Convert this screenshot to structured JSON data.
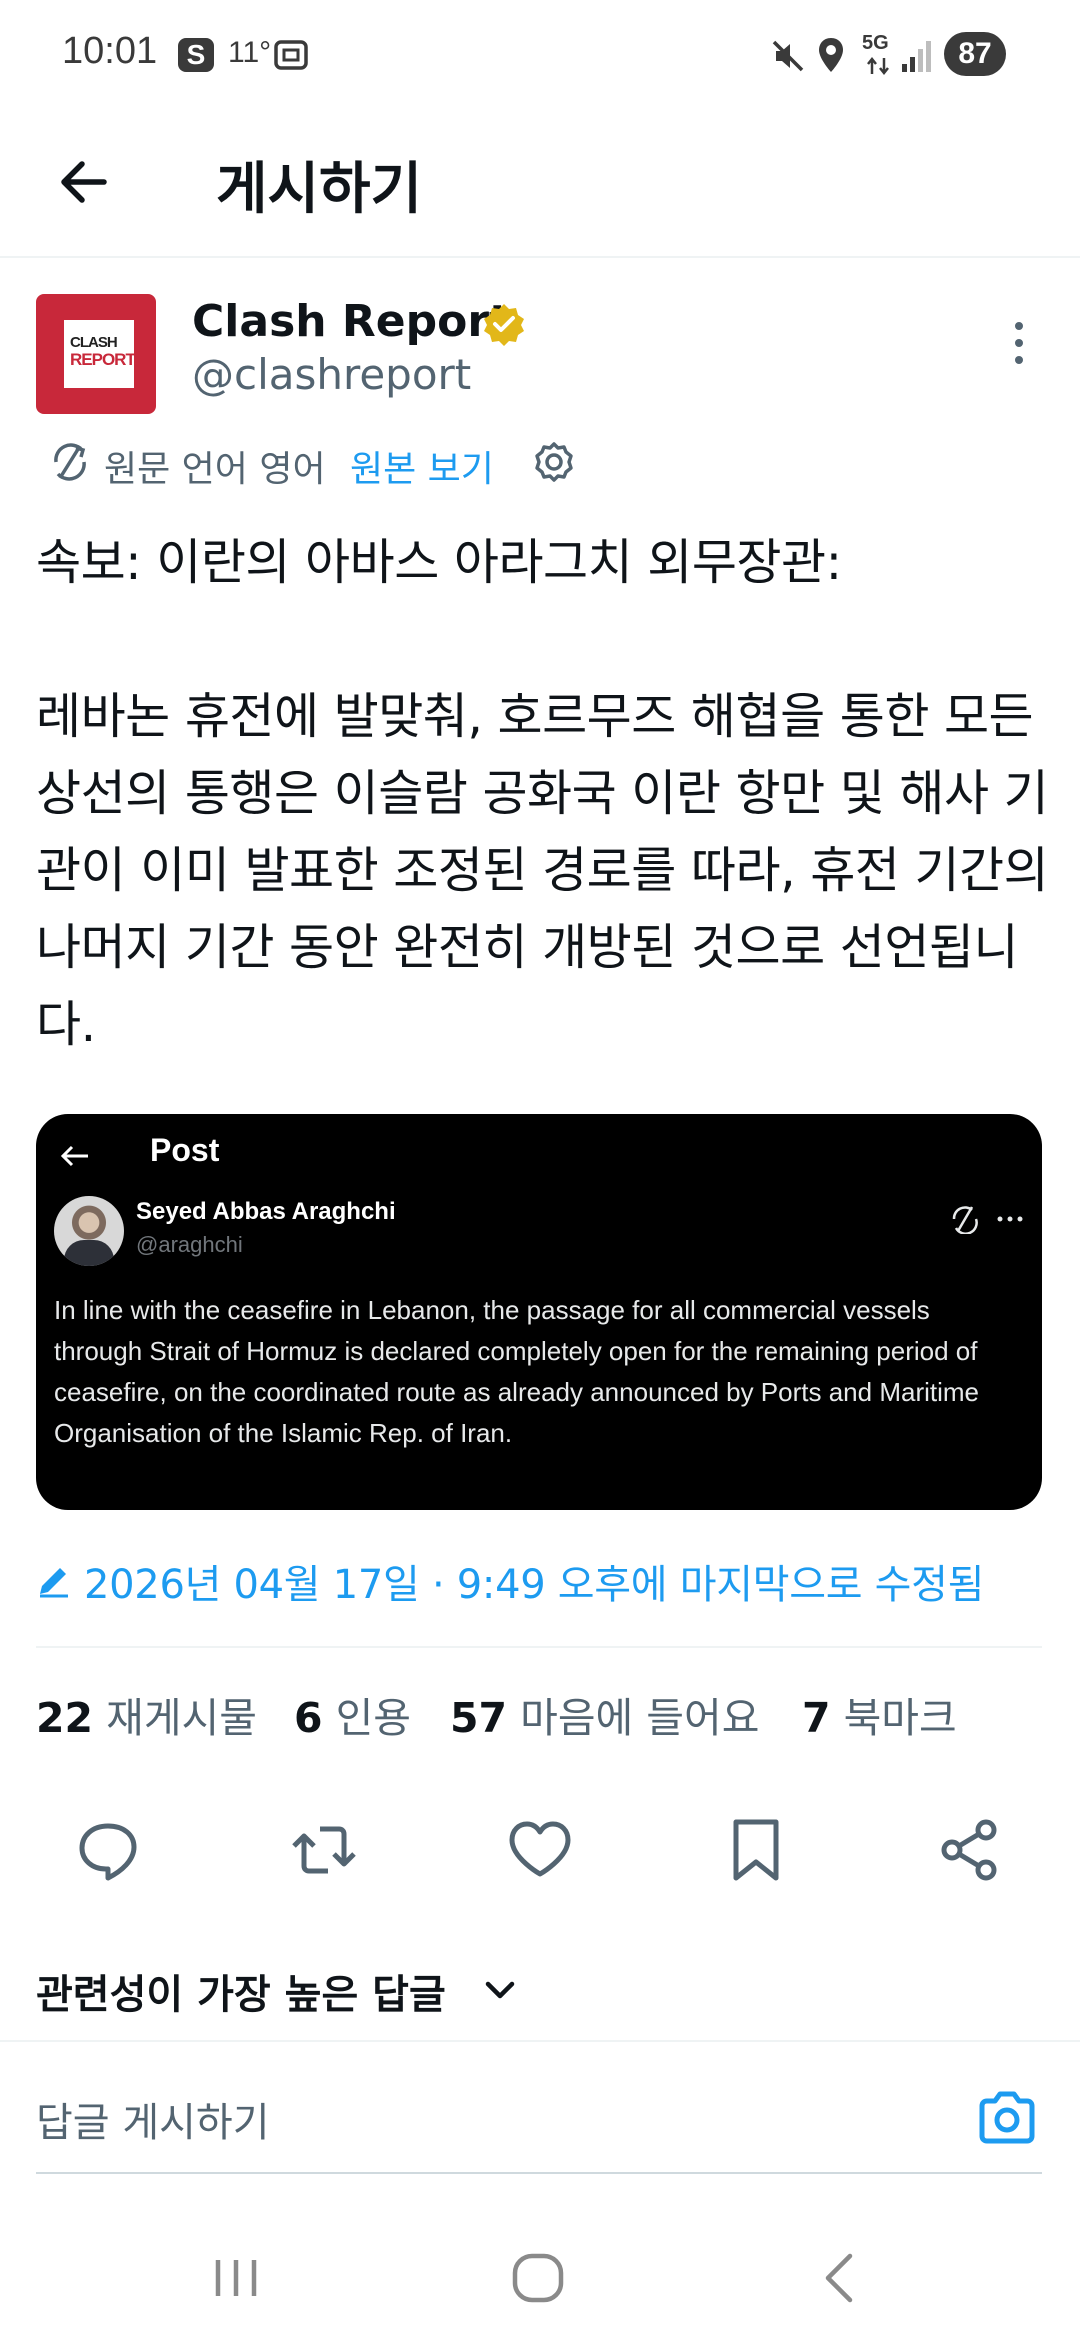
{
  "status_bar": {
    "time": "10:01",
    "s_badge": "S",
    "temperature": "11°",
    "network": "5G",
    "battery": "87"
  },
  "header": {
    "title": "게시하기"
  },
  "author": {
    "name": "Clash Report",
    "handle": "@clashreport",
    "avatar_line1": "CLASH",
    "avatar_line2": "REPORT",
    "brand_color": "#c8283a"
  },
  "translation": {
    "label": "원문 언어 영어",
    "link": "원본 보기"
  },
  "post": {
    "text": "속보: 이란의 아바스 아라그치 외무장관:\n\n레바논 휴전에 발맞춰, 호르무즈 해협을 통한 모든 상선의 통행은 이슬람 공화국 이란 항만 및 해사 기관이 이미 발표한 조정된 경로를 따라, 휴전 기간의 나머지 기간 동안 완전히 개방된 것으로 선언됩니다."
  },
  "embedded": {
    "title": "Post",
    "name": "Seyed Abbas Araghchi",
    "handle": "@araghchi",
    "text": "In line with the ceasefire in Lebanon, the passage for all commercial vessels through Strait of Hormuz is declared completely open for the remaining period of ceasefire, on the coordinated route as already announced by Ports and Maritime Organisation of the Islamic Rep. of Iran."
  },
  "edited": {
    "text": "2026년 04월 17일 · 9:49 오후에 마지막으로 수정됨"
  },
  "stats": [
    {
      "count": "22",
      "label": "재게시물"
    },
    {
      "count": "6",
      "label": "인용"
    },
    {
      "count": "57",
      "label": "마음에 들어요"
    },
    {
      "count": "7",
      "label": "북마크"
    }
  ],
  "actions": {
    "reply_icon": "reply-icon",
    "repost_icon": "repost-icon",
    "like_icon": "heart-icon",
    "bookmark_icon": "bookmark-icon",
    "share_icon": "share-icon"
  },
  "replies": {
    "sort_label": "관련성이 가장 높은 답글"
  },
  "composer": {
    "placeholder": "답글 게시하기"
  },
  "colors": {
    "accent": "#1d9bf0",
    "text": "#0f1419",
    "secondary": "#536471",
    "verified": "#e2b719"
  }
}
